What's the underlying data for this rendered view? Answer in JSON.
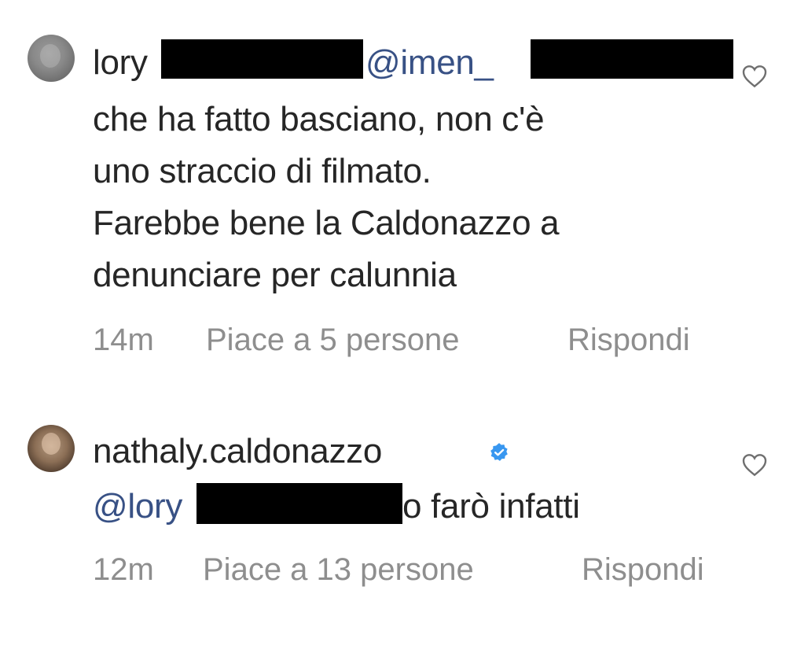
{
  "comments": [
    {
      "username": "lory",
      "mention": "@imen_",
      "text_lines": [
        "che ha fatto basciano, non c'è",
        "uno straccio di filmato.",
        "Farebbe bene la Caldonazzo a",
        "denunciare per calunnia"
      ],
      "time": "14m",
      "likes": "Piace a 5 persone",
      "reply": "Rispondi",
      "icons": {
        "avatar": "avatar",
        "like": "heart-icon"
      }
    },
    {
      "username": "nathaly.caldonazzo",
      "verified": true,
      "mention": "@lory",
      "text_after_mention": "o farò infatti",
      "time": "12m",
      "likes": "Piace a 13 persone",
      "reply": "Rispondi",
      "icons": {
        "avatar": "avatar",
        "verified": "verified-badge-icon",
        "like": "heart-icon"
      }
    }
  ],
  "colors": {
    "text": "#262626",
    "mention": "#385185",
    "meta": "#8e8e8e",
    "verified": "#3897f0",
    "redaction": "#000000"
  }
}
